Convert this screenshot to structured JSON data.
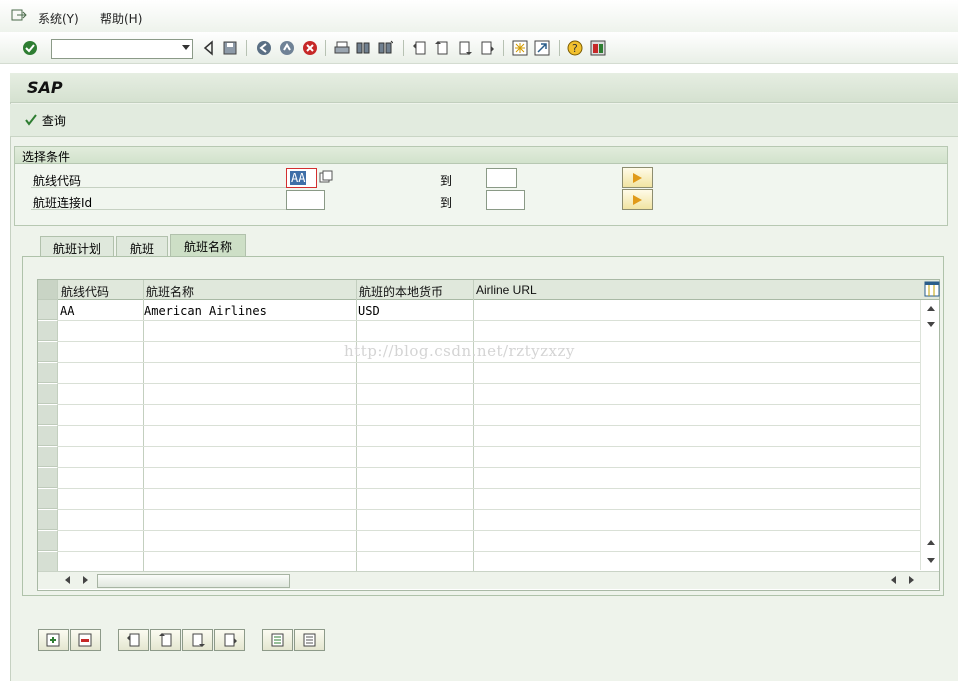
{
  "menubar": {
    "items": [
      "系统(Y)",
      "帮助(H)"
    ]
  },
  "toolbar": {
    "command_field_value": "",
    "icons": [
      "enter-icon",
      "back-icon",
      "save-icon",
      "back-nav-icon",
      "exit-icon",
      "cancel-icon",
      "print-icon",
      "find-icon",
      "find-next-icon",
      "first-page-icon",
      "prev-page-icon",
      "next-page-icon",
      "last-page-icon",
      "create-session-icon",
      "shortcut-icon",
      "help-icon",
      "layout-icon"
    ]
  },
  "app": {
    "title": "SAP",
    "query_button": "查询"
  },
  "selection": {
    "title": "选择条件",
    "rows": [
      {
        "label": "航线代码",
        "from": "AA",
        "to_label": "到",
        "to": ""
      },
      {
        "label": "航班连接Id",
        "from": "",
        "to_label": "到",
        "to": ""
      }
    ]
  },
  "tabs": [
    {
      "label": "航班计划",
      "active": false
    },
    {
      "label": "航班",
      "active": false
    },
    {
      "label": "航班名称",
      "active": true
    }
  ],
  "table": {
    "columns": [
      "航线代码",
      "航班名称",
      "航班的本地货币",
      "Airline URL"
    ],
    "rows": [
      [
        "AA",
        "American Airlines",
        "USD",
        ""
      ]
    ]
  },
  "watermark": "http://blog.csdn.net/rztyzxzy",
  "colors": {
    "background": "#eef3eb",
    "accent": "#e09a19",
    "header": "#e0e8dc"
  }
}
